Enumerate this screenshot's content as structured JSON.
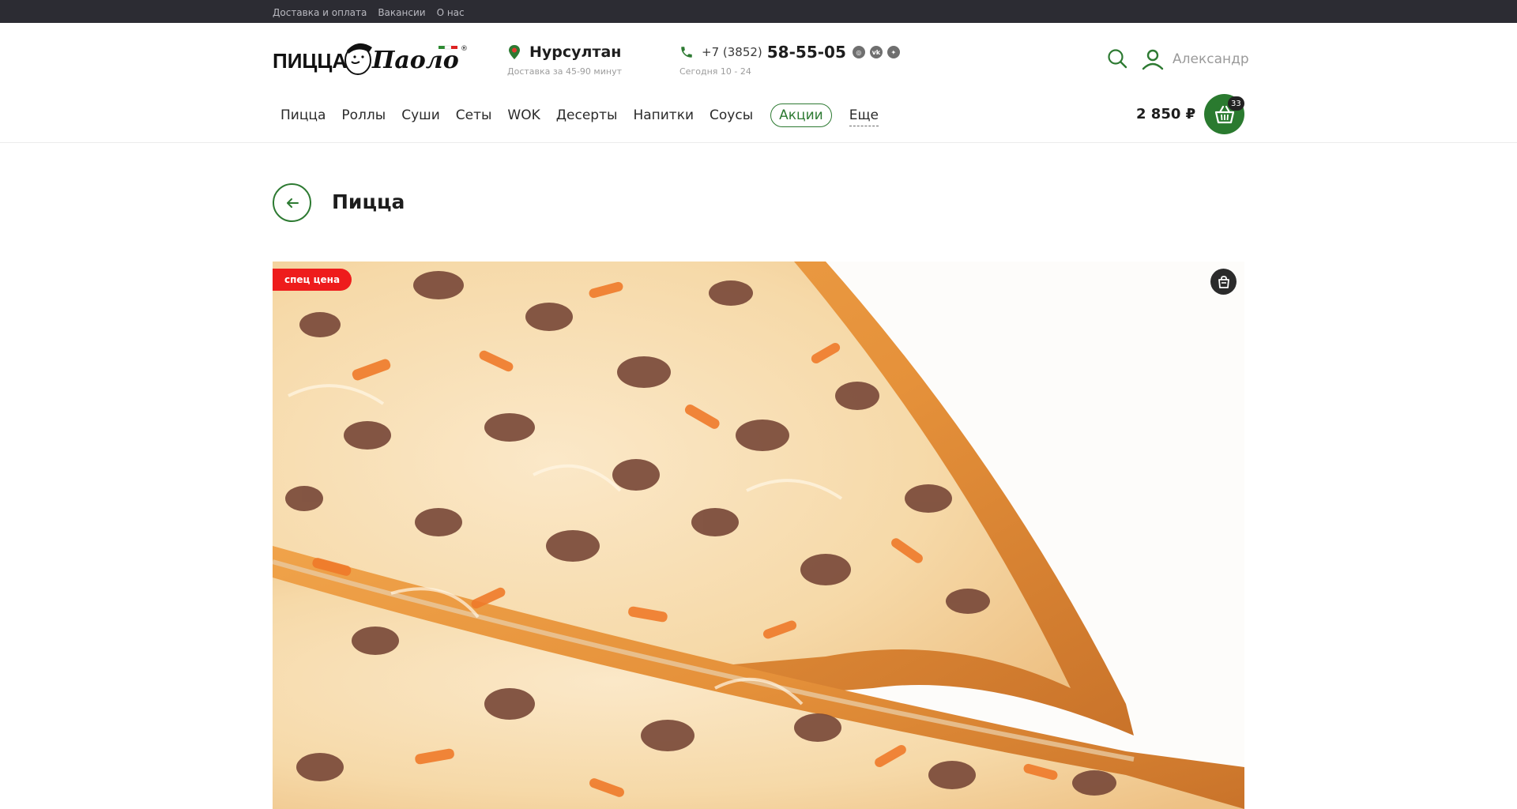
{
  "topbar": {
    "links": [
      "Доставка и оплата",
      "Вакансии",
      "О нас"
    ]
  },
  "brand": {
    "logo_text_left": "ПИЦЦА",
    "logo_text_right": "Паоло",
    "logo_reg": "®"
  },
  "location": {
    "city": "Нурсултан",
    "delivery_time": "Доставка за 45-90 минут"
  },
  "contacts": {
    "phone_prefix": "+7 (3852)",
    "phone_number": "58-55-05",
    "hours": "Сегодня 10 - 24",
    "social_icons": [
      "instagram-icon",
      "vk-icon",
      "tripadvisor-icon"
    ]
  },
  "user": {
    "name": "Александр"
  },
  "nav": {
    "items": [
      "Пицца",
      "Роллы",
      "Суши",
      "Сеты",
      "WOK",
      "Десерты",
      "Напитки",
      "Соусы"
    ],
    "promo": "Акции",
    "more": "Еще"
  },
  "cart": {
    "total": "2 850 ₽",
    "count": "33"
  },
  "page": {
    "title": "Пицца"
  },
  "product": {
    "badge": "спец цена"
  },
  "colors": {
    "brand_green": "#2d7a32",
    "topbar": "#2c2c33",
    "badge_red": "#ee1c1c"
  }
}
